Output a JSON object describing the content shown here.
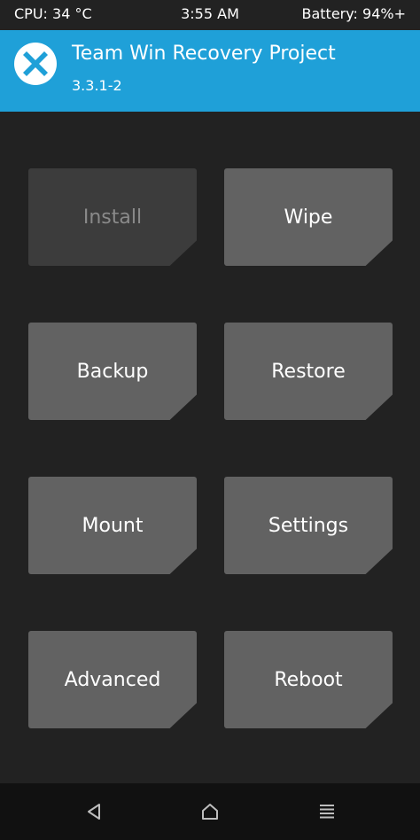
{
  "status_bar": {
    "cpu": "CPU: 34 °C",
    "time": "3:55 AM",
    "battery": "Battery: 94%+"
  },
  "header": {
    "title": "Team Win Recovery Project",
    "version": "3.3.1-2",
    "logo_icon": "twrp-logo-icon",
    "background_color": "#1fa0d8"
  },
  "menu": {
    "install": "Install",
    "wipe": "Wipe",
    "backup": "Backup",
    "restore": "Restore",
    "mount": "Mount",
    "settings": "Settings",
    "advanced": "Advanced",
    "reboot": "Reboot"
  },
  "nav_bar": {
    "back_icon": "back-triangle-icon",
    "home_icon": "home-icon",
    "menu_icon": "menu-lines-icon"
  }
}
